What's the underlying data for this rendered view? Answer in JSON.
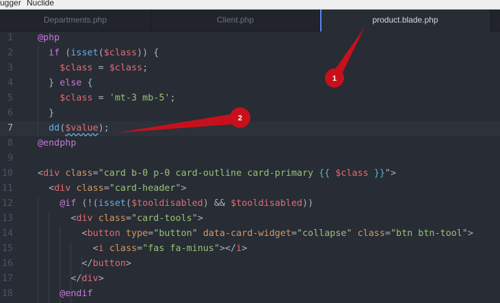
{
  "menubar": {
    "items": [
      "ugger",
      "Nuclide"
    ]
  },
  "tabs": [
    {
      "label": "Departments.php",
      "active": false
    },
    {
      "label": "Client.php",
      "active": false
    },
    {
      "label": "product.blade.php",
      "active": true
    }
  ],
  "active_tab_close": "ᐧ",
  "colors": {
    "accent": "#568af2",
    "annotation": "#d0021b"
  },
  "annotations": [
    "1",
    "2"
  ],
  "line_numbers": [
    "1",
    "2",
    "3",
    "4",
    "5",
    "6",
    "7",
    "8",
    "9",
    "10",
    "11",
    "12",
    "13",
    "14",
    "15",
    "16",
    "17",
    "18"
  ],
  "current_line": "7",
  "lines": [
    [
      {
        "t": "@php",
        "c": "kw"
      }
    ],
    [
      {
        "t": "  "
      },
      {
        "t": "if",
        "c": "kw"
      },
      {
        "t": " (",
        "c": "pl"
      },
      {
        "t": "isset",
        "c": "fn"
      },
      {
        "t": "(",
        "c": "pl"
      },
      {
        "t": "$class",
        "c": "var"
      },
      {
        "t": ")) {",
        "c": "pl"
      }
    ],
    [
      {
        "t": "    "
      },
      {
        "t": "$class",
        "c": "var"
      },
      {
        "t": " = ",
        "c": "pl"
      },
      {
        "t": "$class",
        "c": "var"
      },
      {
        "t": ";",
        "c": "pl"
      }
    ],
    [
      {
        "t": "  "
      },
      {
        "t": "} ",
        "c": "pl"
      },
      {
        "t": "else",
        "c": "kw"
      },
      {
        "t": " {",
        "c": "pl"
      }
    ],
    [
      {
        "t": "    "
      },
      {
        "t": "$class",
        "c": "var"
      },
      {
        "t": " = ",
        "c": "pl"
      },
      {
        "t": "'mt-3 mb-5'",
        "c": "str"
      },
      {
        "t": ";",
        "c": "pl"
      }
    ],
    [
      {
        "t": "  "
      },
      {
        "t": "}",
        "c": "pl"
      }
    ],
    [
      {
        "t": "  "
      },
      {
        "t": "dd",
        "c": "fn"
      },
      {
        "t": "(",
        "c": "pl"
      },
      {
        "t": "$value",
        "c": "var wavy"
      },
      {
        "t": ");",
        "c": "pl"
      }
    ],
    [
      {
        "t": "@endphp",
        "c": "kw"
      }
    ],
    [],
    [
      {
        "t": "<",
        "c": "pl"
      },
      {
        "t": "div",
        "c": "tag"
      },
      {
        "t": " "
      },
      {
        "t": "class",
        "c": "attr"
      },
      {
        "t": "=",
        "c": "pl"
      },
      {
        "t": "\"card b-0 p-0 card-outline card-primary ",
        "c": "str"
      },
      {
        "t": "{{",
        "c": "bl"
      },
      {
        "t": " "
      },
      {
        "t": "$class",
        "c": "var"
      },
      {
        "t": " "
      },
      {
        "t": "}}",
        "c": "bl"
      },
      {
        "t": "\"",
        "c": "str"
      },
      {
        "t": ">",
        "c": "pl"
      }
    ],
    [
      {
        "t": "  "
      },
      {
        "t": "<",
        "c": "pl"
      },
      {
        "t": "div",
        "c": "tag"
      },
      {
        "t": " "
      },
      {
        "t": "class",
        "c": "attr"
      },
      {
        "t": "=",
        "c": "pl"
      },
      {
        "t": "\"card-header\"",
        "c": "str"
      },
      {
        "t": ">",
        "c": "pl"
      }
    ],
    [
      {
        "t": "    "
      },
      {
        "t": "@if",
        "c": "kw"
      },
      {
        "t": " (!(",
        "c": "pl"
      },
      {
        "t": "isset",
        "c": "fn"
      },
      {
        "t": "(",
        "c": "pl"
      },
      {
        "t": "$tooldisabled",
        "c": "var"
      },
      {
        "t": ") && ",
        "c": "pl"
      },
      {
        "t": "$tooldisabled",
        "c": "var"
      },
      {
        "t": "))",
        "c": "pl"
      }
    ],
    [
      {
        "t": "      "
      },
      {
        "t": "<",
        "c": "pl"
      },
      {
        "t": "div",
        "c": "tag"
      },
      {
        "t": " "
      },
      {
        "t": "class",
        "c": "attr"
      },
      {
        "t": "=",
        "c": "pl"
      },
      {
        "t": "\"card-tools\"",
        "c": "str"
      },
      {
        "t": ">",
        "c": "pl"
      }
    ],
    [
      {
        "t": "        "
      },
      {
        "t": "<",
        "c": "pl"
      },
      {
        "t": "button",
        "c": "tag"
      },
      {
        "t": " "
      },
      {
        "t": "type",
        "c": "attr"
      },
      {
        "t": "=",
        "c": "pl"
      },
      {
        "t": "\"button\"",
        "c": "str"
      },
      {
        "t": " "
      },
      {
        "t": "data-card-widget",
        "c": "attr"
      },
      {
        "t": "=",
        "c": "pl"
      },
      {
        "t": "\"collapse\"",
        "c": "str"
      },
      {
        "t": " "
      },
      {
        "t": "class",
        "c": "attr"
      },
      {
        "t": "=",
        "c": "pl"
      },
      {
        "t": "\"btn btn-tool\"",
        "c": "str"
      },
      {
        "t": ">",
        "c": "pl"
      }
    ],
    [
      {
        "t": "          "
      },
      {
        "t": "<",
        "c": "pl"
      },
      {
        "t": "i",
        "c": "tag"
      },
      {
        "t": " "
      },
      {
        "t": "class",
        "c": "attr"
      },
      {
        "t": "=",
        "c": "pl"
      },
      {
        "t": "\"fas fa-minus\"",
        "c": "str"
      },
      {
        "t": "></",
        "c": "pl"
      },
      {
        "t": "i",
        "c": "tag"
      },
      {
        "t": ">",
        "c": "pl"
      }
    ],
    [
      {
        "t": "        "
      },
      {
        "t": "</",
        "c": "pl"
      },
      {
        "t": "button",
        "c": "tag"
      },
      {
        "t": ">",
        "c": "pl"
      }
    ],
    [
      {
        "t": "      "
      },
      {
        "t": "</",
        "c": "pl"
      },
      {
        "t": "div",
        "c": "tag"
      },
      {
        "t": ">",
        "c": "pl"
      }
    ],
    [
      {
        "t": "    "
      },
      {
        "t": "@endif",
        "c": "kw"
      }
    ]
  ]
}
